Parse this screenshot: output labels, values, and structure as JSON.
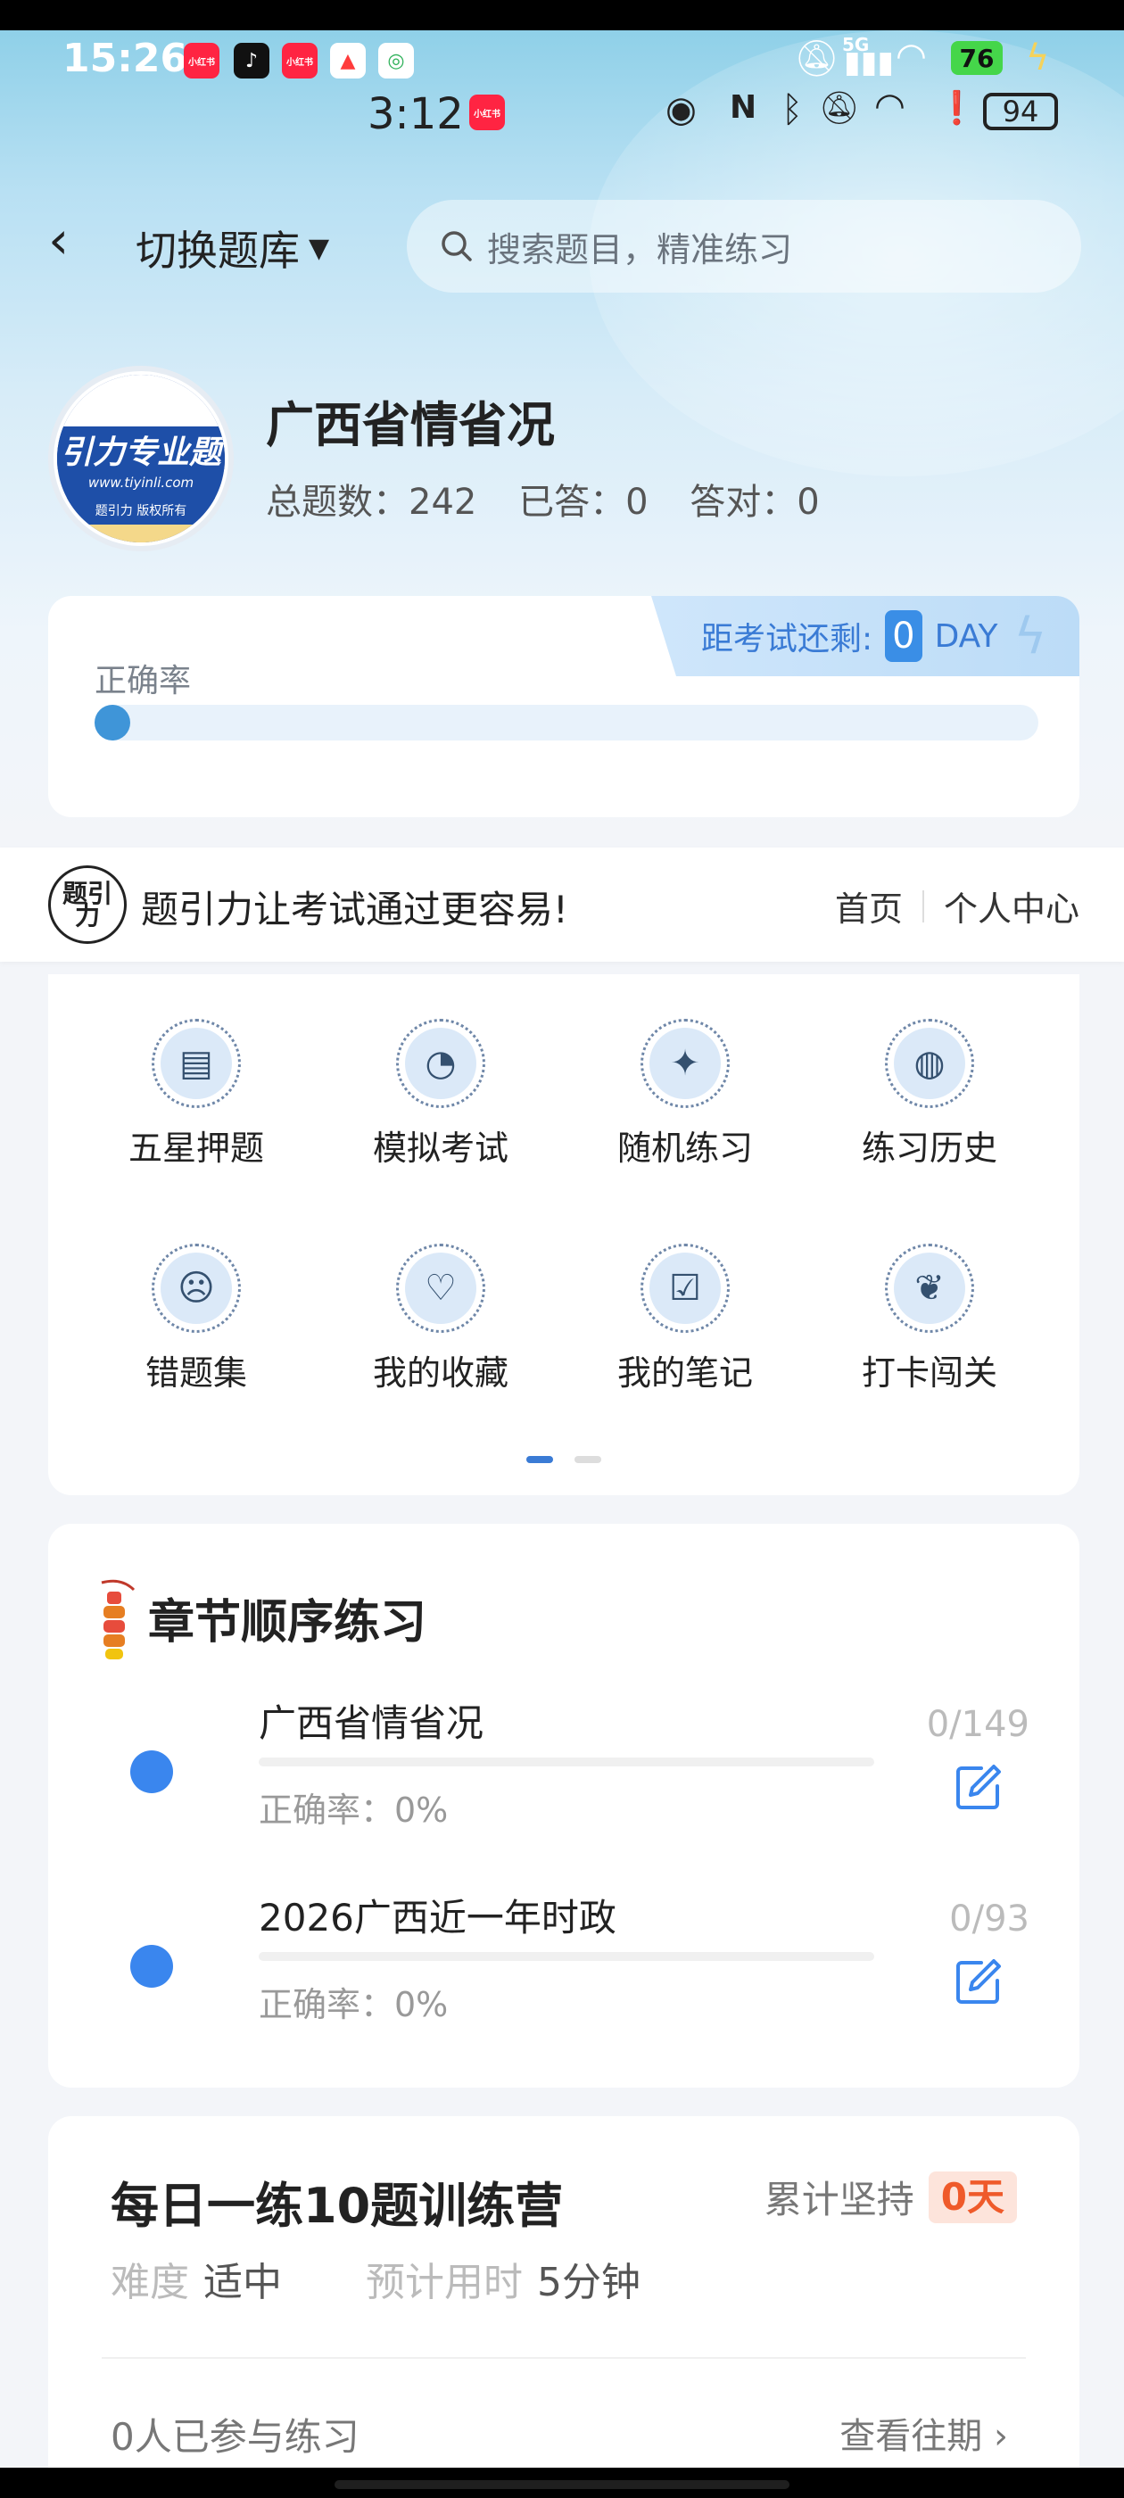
{
  "status_bar_outer": {
    "time": "15:26",
    "app_icons": [
      {
        "name": "xiaohongshu-icon",
        "text": "小红书",
        "color": "#ff2442"
      },
      {
        "name": "tiktok-icon",
        "text": "♪",
        "color": "#111111"
      },
      {
        "name": "xiaohongshu-icon-2",
        "text": "小红书",
        "color": "#ff2442"
      },
      {
        "name": "app-a-icon",
        "text": "▲",
        "color": "#ff3b3b"
      },
      {
        "name": "chat-icon",
        "text": "◎",
        "color": "#ffffff"
      }
    ],
    "network": "5G",
    "battery": "76"
  },
  "status_bar_inner": {
    "time": "3:12",
    "app_icon_text": "小红书",
    "battery": "94"
  },
  "nav": {
    "switch_label": "切换题库",
    "search_placeholder": "搜索题目，精准练习"
  },
  "bank": {
    "logo_text": "引力专业题",
    "logo_url": "www.tiyinli.com",
    "logo_footer": "题引力 版权所有",
    "title": "广西省情省况",
    "total": "总题数：242",
    "answered": "已答：0",
    "correct": "答对：0"
  },
  "countdown": {
    "prefix": "距考试还剩:",
    "days": "0",
    "unit": "DAY"
  },
  "accuracy": {
    "label": "正确率",
    "value": 0
  },
  "banner": {
    "logo_text": "题引力",
    "slogan": "题引力让考试通过更容易!",
    "home": "首页",
    "personal": "个人中心"
  },
  "features": [
    {
      "label": "五星押题",
      "icon": "id-card-icon",
      "glyph": "▤"
    },
    {
      "label": "模拟考试",
      "icon": "gauge-icon",
      "glyph": "◔"
    },
    {
      "label": "随机练习",
      "icon": "star-icon",
      "glyph": "✦"
    },
    {
      "label": "练习历史",
      "icon": "globe-icon",
      "glyph": "◍"
    },
    {
      "label": "错题集",
      "icon": "head-icon",
      "glyph": "☹"
    },
    {
      "label": "我的收藏",
      "icon": "heart-icon",
      "glyph": "♡"
    },
    {
      "label": "我的笔记",
      "icon": "check-note-icon",
      "glyph": "☑"
    },
    {
      "label": "打卡闯关",
      "icon": "leaf-icon",
      "glyph": "❦"
    }
  ],
  "chapter": {
    "title": "章节顺序练习",
    "items": [
      {
        "name": "广西省情省况",
        "accuracy": "正确率：0%",
        "count": "0/149"
      },
      {
        "name": "2026广西近一年时政",
        "accuracy": "正确率：0%",
        "count": "0/93"
      }
    ]
  },
  "daily": {
    "title": "每日一练10题训练营",
    "streak_label": "累计坚持",
    "streak_value": "0天",
    "difficulty_label": "难度",
    "difficulty_value": "适中",
    "time_label": "预计用时",
    "time_value": "5分钟",
    "participants": "0人已参与练习",
    "history": "查看往期"
  },
  "colors": {
    "accent": "#3a86ee",
    "streak": "#ef5a2a",
    "page_bg": "#f3f5f9"
  }
}
